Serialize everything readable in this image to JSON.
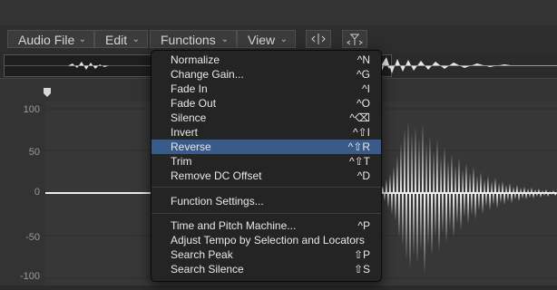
{
  "menubar": {
    "items": [
      {
        "label": "Audio File"
      },
      {
        "label": "Edit"
      },
      {
        "label": "Functions"
      },
      {
        "label": "View"
      }
    ]
  },
  "axis": {
    "ticks": [
      "100",
      "50",
      "0",
      "-50",
      "-100"
    ]
  },
  "functions_menu": {
    "items": [
      {
        "label": "Normalize",
        "shortcut": "^N"
      },
      {
        "label": "Change Gain...",
        "shortcut": "^G"
      },
      {
        "label": "Fade In",
        "shortcut": "^I"
      },
      {
        "label": "Fade Out",
        "shortcut": "^O"
      },
      {
        "label": "Silence",
        "shortcut": "^⌫"
      },
      {
        "label": "Invert",
        "shortcut": "^⇧I"
      },
      {
        "label": "Reverse",
        "shortcut": "^⇧R"
      },
      {
        "label": "Trim",
        "shortcut": "^⇧T"
      },
      {
        "label": "Remove DC Offset",
        "shortcut": "^D"
      },
      {
        "label": "Function Settings...",
        "shortcut": ""
      },
      {
        "label": "Time and Pitch Machine...",
        "shortcut": "^P"
      },
      {
        "label": "Adjust Tempo by Selection and Locators",
        "shortcut": ""
      },
      {
        "label": "Search Peak",
        "shortcut": "⇧P"
      },
      {
        "label": "Search Silence",
        "shortcut": "⇧S"
      }
    ],
    "highlighted": "Reverse"
  },
  "colors": {
    "highlight": "#385b8a",
    "waveform": "#ececec"
  }
}
